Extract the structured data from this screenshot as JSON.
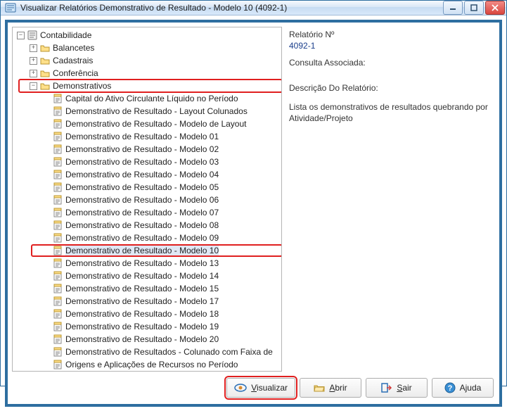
{
  "window": {
    "title": "Visualizar Relatórios Demonstrativo de Resultado - Modelo 10 (4092-1)"
  },
  "tree": {
    "root": {
      "label": "Contabilidade",
      "children": [
        {
          "label": "Balancetes"
        },
        {
          "label": "Cadastrais"
        },
        {
          "label": "Conferência"
        },
        {
          "label": "Demonstrativos"
        }
      ]
    },
    "demonstrativos_children": [
      "Capital do Ativo Circulante Líquido no Período",
      "Demonstrativo de Resultado - Layout Colunados",
      "Demonstrativo de Resultado - Modelo de Layout",
      "Demonstrativo de Resultado - Modelo 01",
      "Demonstrativo de Resultado - Modelo 02",
      "Demonstrativo de Resultado - Modelo 03",
      "Demonstrativo de Resultado - Modelo 04",
      "Demonstrativo de Resultado - Modelo 05",
      "Demonstrativo de Resultado - Modelo 06",
      "Demonstrativo de Resultado - Modelo 07",
      "Demonstrativo de Resultado - Modelo 08",
      "Demonstrativo de Resultado - Modelo 09",
      "Demonstrativo de Resultado - Modelo 10",
      "Demonstrativo de Resultado - Modelo 13",
      "Demonstrativo de Resultado - Modelo 14",
      "Demonstrativo de Resultado - Modelo 15",
      "Demonstrativo de Resultado - Modelo 17",
      "Demonstrativo de Resultado - Modelo 18",
      "Demonstrativo de Resultado - Modelo 19",
      "Demonstrativo de Resultado - Modelo 20",
      "Demonstrativo de Resultados - Colunado com Faixa de",
      "Origens e Aplicações de Recursos no Período"
    ],
    "selected_index": 12
  },
  "detail": {
    "relatorio_label": "Relatório Nº",
    "relatorio_value": "4092-1",
    "consulta_label": "Consulta Associada:",
    "descricao_label": "Descrição Do Relatório:",
    "descricao_text": "Lista os demonstrativos de resultados quebrando por Atividade/Projeto"
  },
  "buttons": {
    "visualizar": {
      "prefix": "V",
      "rest": "isualizar"
    },
    "abrir": {
      "prefix": "A",
      "rest": "brir"
    },
    "sair": {
      "prefix": "S",
      "rest": "air"
    },
    "ajuda": {
      "text": "Ajuda"
    }
  },
  "glyphs": {
    "plus": "+",
    "minus": "−"
  },
  "colors": {
    "accent": "#2e6ea0",
    "highlight": "#e02020"
  }
}
